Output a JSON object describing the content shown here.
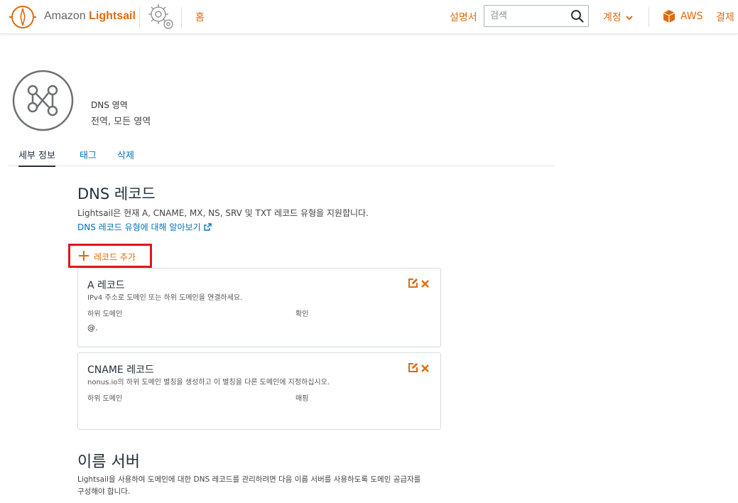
{
  "header": {
    "logo_prefix": "Amazon",
    "logo_brand": "Lightsail",
    "home": "홈",
    "docs": "설명서",
    "search_placeholder": "검색",
    "account": "계정",
    "aws": "AWS",
    "billing": "결제"
  },
  "resource": {
    "type_label": "DNS 영역",
    "scope": "전역, 모든 영역"
  },
  "tabs": [
    {
      "label": "세부 정보",
      "active": true
    },
    {
      "label": "태그",
      "active": false
    },
    {
      "label": "삭제",
      "active": false
    }
  ],
  "dns_records": {
    "title": "DNS 레코드",
    "description": "Lightsail은 현재 A, CNAME, MX, NS, SRV 및 TXT 레코드 유형을 지원합니다.",
    "learn_link": "DNS 레코드 유형에 대해 알아보기",
    "add_button": "레코드 추가",
    "cards": [
      {
        "title": "A 레코드",
        "description": "IPv4 주소로 도메인 또는 하위 도메인을 연결하세요.",
        "col1": "하위 도메인",
        "col2": "확인",
        "val1": "@.",
        "val2": ""
      },
      {
        "title": "CNAME 레코드",
        "description": "nonus.io의 하위 도메인 별칭을 생성하고 이 별칭을 다른 도메인에 지정하십시오.",
        "col1": "하위 도메인",
        "col2": "매핑",
        "val1": "",
        "val2": ""
      }
    ]
  },
  "name_servers": {
    "title": "이름 서버",
    "description": "Lightsail을 사용하여 도메인에 대한 DNS 레코드를 관리하려면 다음 이름 서버를 사용하도록 도메인 공급자를 구성해야 합니다."
  },
  "colors": {
    "accent": "#dd6b10",
    "link": "#0073bb",
    "highlight": "#e0161f",
    "text": "#232f3e"
  },
  "icons": [
    "lightsail-logo-icon",
    "gear-icon",
    "search-icon",
    "chevron-down-icon",
    "aws-cube-icon",
    "dns-zone-icon",
    "external-link-icon",
    "plus-icon",
    "edit-icon",
    "delete-icon"
  ]
}
